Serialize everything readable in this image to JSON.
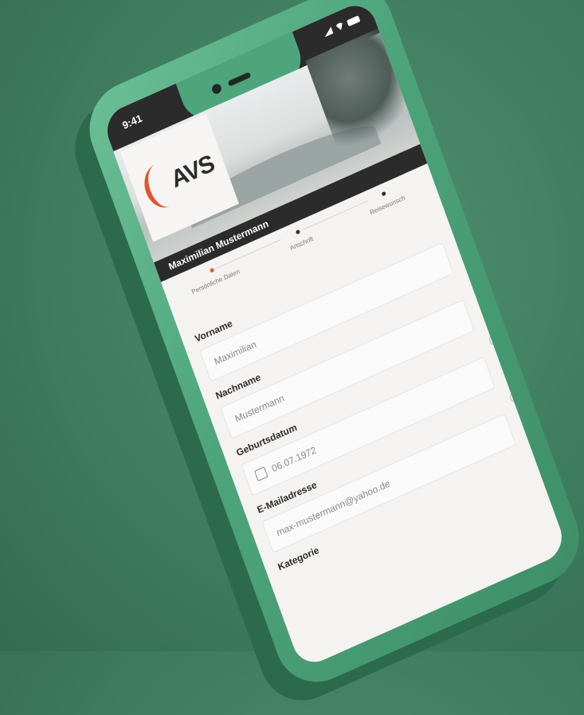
{
  "status_bar": {
    "time": "9:41"
  },
  "logo": {
    "text": "AVS"
  },
  "user": {
    "name": "Maximilian Mustermann"
  },
  "steps": [
    {
      "label": "Persönliche Daten",
      "active": true
    },
    {
      "label": "Anschrift",
      "active": false
    },
    {
      "label": "Reisewunsch",
      "active": false
    }
  ],
  "form": {
    "first_name": {
      "label": "Vorname",
      "value": "Maximilian"
    },
    "last_name": {
      "label": "Nachname",
      "value": "Mustermann"
    },
    "birthdate": {
      "label": "Geburtsdatum",
      "value": "06.07.1972"
    },
    "email": {
      "label": "E-Mailadresse",
      "value": "max-mustermann@yahoo.de"
    },
    "category": {
      "label": "Kategorie"
    }
  },
  "colors": {
    "accent": "#e0542f",
    "phone": "#4ea57b",
    "background": "#3f7d61",
    "dark": "#2b2b2b"
  }
}
